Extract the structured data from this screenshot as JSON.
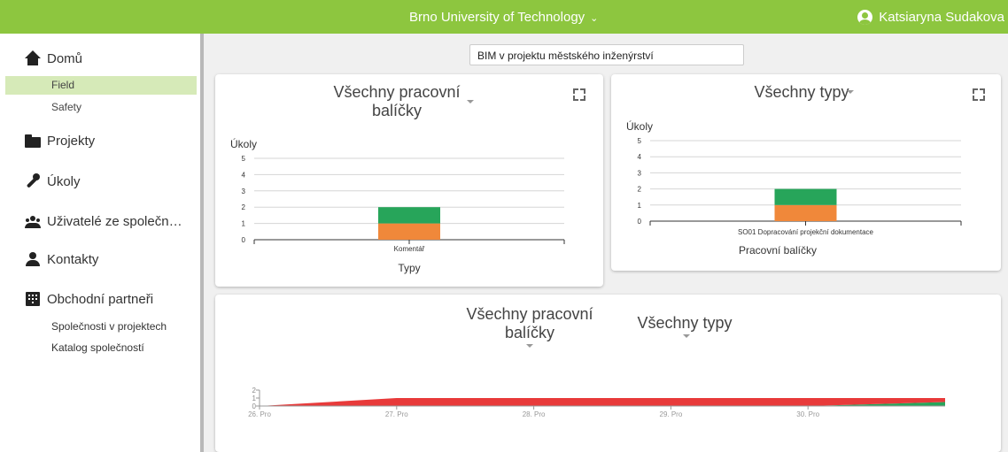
{
  "header": {
    "organization": "Brno University of Technology",
    "user_name": "Katsiaryna Sudakova",
    "bar_color": "#8dc63f"
  },
  "sidebar": {
    "home": {
      "label": "Domů",
      "icon": "home-icon"
    },
    "home_sub": [
      {
        "label": "Field",
        "active": true
      },
      {
        "label": "Safety",
        "active": false
      }
    ],
    "projects": {
      "label": "Projekty",
      "icon": "folder-icon"
    },
    "tasks": {
      "label": "Úkoly",
      "icon": "wrench-icon"
    },
    "company_users": {
      "label": "Uživatelé ze společn…",
      "icon": "group-icon"
    },
    "contacts": {
      "label": "Kontakty",
      "icon": "person-icon"
    },
    "partners": {
      "label": "Obchodní partneři",
      "icon": "building-icon"
    },
    "partners_sub": [
      {
        "label": "Společnosti v projektech"
      },
      {
        "label": "Katalog společností"
      }
    ]
  },
  "project_selector": {
    "value": "BIM v projektu městského inženýrství"
  },
  "card1": {
    "filter_line1": "Všechny pracovní",
    "filter_line2": "balíčky"
  },
  "card2": {
    "filter": "Všechny typy"
  },
  "card3": {
    "filter1_line1": "Všechny pracovní",
    "filter1_line2": "balíčky",
    "filter2": "Všechny typy"
  },
  "colors": {
    "green": "#27a55a",
    "orange": "#f0883a",
    "red": "#e83a3a"
  },
  "chart_data": [
    {
      "type": "bar",
      "stacked": true,
      "ylabel": "Úkoly",
      "xlabel": "Typy",
      "ylim": [
        0,
        5
      ],
      "yticks": [
        "0",
        "1",
        "2",
        "3",
        "4",
        "5"
      ],
      "categories": [
        "Komentář"
      ],
      "series": [
        {
          "color": "#f0883a",
          "values": [
            1
          ]
        },
        {
          "color": "#27a55a",
          "values": [
            1
          ]
        }
      ]
    },
    {
      "type": "bar",
      "stacked": true,
      "ylabel": "Úkoly",
      "xlabel": "Pracovní balíčky",
      "ylim": [
        0,
        5
      ],
      "yticks": [
        "0",
        "1",
        "2",
        "3",
        "4",
        "5"
      ],
      "categories": [
        "SO01 Dopracování projekční dokumentace"
      ],
      "series": [
        {
          "color": "#f0883a",
          "values": [
            1
          ]
        },
        {
          "color": "#27a55a",
          "values": [
            1
          ]
        }
      ]
    },
    {
      "type": "area",
      "stacked": true,
      "ylim": [
        0,
        2
      ],
      "yticks": [
        "0",
        "1",
        "2"
      ],
      "xticks": [
        "26. Pro",
        "27. Pro",
        "28. Pro",
        "29. Pro",
        "30. Pro"
      ],
      "x": [
        0,
        1,
        2,
        3,
        4,
        5
      ],
      "series": [
        {
          "color": "#27a55a",
          "values": [
            0,
            0,
            0,
            0,
            0,
            0.5
          ]
        },
        {
          "color": "#e83a3a",
          "values": [
            0,
            1,
            1,
            1,
            1,
            0.5
          ]
        }
      ]
    }
  ]
}
